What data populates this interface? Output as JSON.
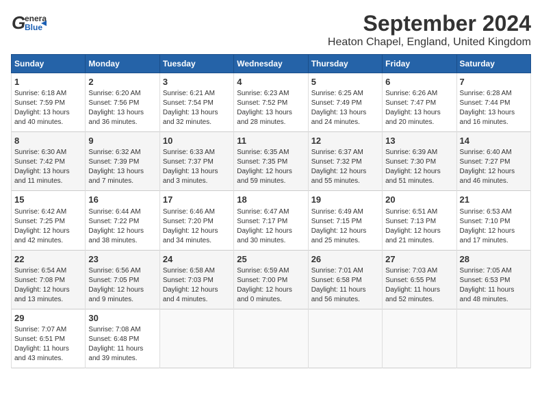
{
  "header": {
    "logo_general": "General",
    "logo_blue": "Blue",
    "title": "September 2024",
    "subtitle": "Heaton Chapel, England, United Kingdom"
  },
  "days_of_week": [
    "Sunday",
    "Monday",
    "Tuesday",
    "Wednesday",
    "Thursday",
    "Friday",
    "Saturday"
  ],
  "weeks": [
    [
      {
        "day": "1",
        "lines": [
          "Sunrise: 6:18 AM",
          "Sunset: 7:59 PM",
          "Daylight: 13 hours",
          "and 40 minutes."
        ]
      },
      {
        "day": "2",
        "lines": [
          "Sunrise: 6:20 AM",
          "Sunset: 7:56 PM",
          "Daylight: 13 hours",
          "and 36 minutes."
        ]
      },
      {
        "day": "3",
        "lines": [
          "Sunrise: 6:21 AM",
          "Sunset: 7:54 PM",
          "Daylight: 13 hours",
          "and 32 minutes."
        ]
      },
      {
        "day": "4",
        "lines": [
          "Sunrise: 6:23 AM",
          "Sunset: 7:52 PM",
          "Daylight: 13 hours",
          "and 28 minutes."
        ]
      },
      {
        "day": "5",
        "lines": [
          "Sunrise: 6:25 AM",
          "Sunset: 7:49 PM",
          "Daylight: 13 hours",
          "and 24 minutes."
        ]
      },
      {
        "day": "6",
        "lines": [
          "Sunrise: 6:26 AM",
          "Sunset: 7:47 PM",
          "Daylight: 13 hours",
          "and 20 minutes."
        ]
      },
      {
        "day": "7",
        "lines": [
          "Sunrise: 6:28 AM",
          "Sunset: 7:44 PM",
          "Daylight: 13 hours",
          "and 16 minutes."
        ]
      }
    ],
    [
      {
        "day": "8",
        "lines": [
          "Sunrise: 6:30 AM",
          "Sunset: 7:42 PM",
          "Daylight: 13 hours",
          "and 11 minutes."
        ]
      },
      {
        "day": "9",
        "lines": [
          "Sunrise: 6:32 AM",
          "Sunset: 7:39 PM",
          "Daylight: 13 hours",
          "and 7 minutes."
        ]
      },
      {
        "day": "10",
        "lines": [
          "Sunrise: 6:33 AM",
          "Sunset: 7:37 PM",
          "Daylight: 13 hours",
          "and 3 minutes."
        ]
      },
      {
        "day": "11",
        "lines": [
          "Sunrise: 6:35 AM",
          "Sunset: 7:35 PM",
          "Daylight: 12 hours",
          "and 59 minutes."
        ]
      },
      {
        "day": "12",
        "lines": [
          "Sunrise: 6:37 AM",
          "Sunset: 7:32 PM",
          "Daylight: 12 hours",
          "and 55 minutes."
        ]
      },
      {
        "day": "13",
        "lines": [
          "Sunrise: 6:39 AM",
          "Sunset: 7:30 PM",
          "Daylight: 12 hours",
          "and 51 minutes."
        ]
      },
      {
        "day": "14",
        "lines": [
          "Sunrise: 6:40 AM",
          "Sunset: 7:27 PM",
          "Daylight: 12 hours",
          "and 46 minutes."
        ]
      }
    ],
    [
      {
        "day": "15",
        "lines": [
          "Sunrise: 6:42 AM",
          "Sunset: 7:25 PM",
          "Daylight: 12 hours",
          "and 42 minutes."
        ]
      },
      {
        "day": "16",
        "lines": [
          "Sunrise: 6:44 AM",
          "Sunset: 7:22 PM",
          "Daylight: 12 hours",
          "and 38 minutes."
        ]
      },
      {
        "day": "17",
        "lines": [
          "Sunrise: 6:46 AM",
          "Sunset: 7:20 PM",
          "Daylight: 12 hours",
          "and 34 minutes."
        ]
      },
      {
        "day": "18",
        "lines": [
          "Sunrise: 6:47 AM",
          "Sunset: 7:17 PM",
          "Daylight: 12 hours",
          "and 30 minutes."
        ]
      },
      {
        "day": "19",
        "lines": [
          "Sunrise: 6:49 AM",
          "Sunset: 7:15 PM",
          "Daylight: 12 hours",
          "and 25 minutes."
        ]
      },
      {
        "day": "20",
        "lines": [
          "Sunrise: 6:51 AM",
          "Sunset: 7:13 PM",
          "Daylight: 12 hours",
          "and 21 minutes."
        ]
      },
      {
        "day": "21",
        "lines": [
          "Sunrise: 6:53 AM",
          "Sunset: 7:10 PM",
          "Daylight: 12 hours",
          "and 17 minutes."
        ]
      }
    ],
    [
      {
        "day": "22",
        "lines": [
          "Sunrise: 6:54 AM",
          "Sunset: 7:08 PM",
          "Daylight: 12 hours",
          "and 13 minutes."
        ]
      },
      {
        "day": "23",
        "lines": [
          "Sunrise: 6:56 AM",
          "Sunset: 7:05 PM",
          "Daylight: 12 hours",
          "and 9 minutes."
        ]
      },
      {
        "day": "24",
        "lines": [
          "Sunrise: 6:58 AM",
          "Sunset: 7:03 PM",
          "Daylight: 12 hours",
          "and 4 minutes."
        ]
      },
      {
        "day": "25",
        "lines": [
          "Sunrise: 6:59 AM",
          "Sunset: 7:00 PM",
          "Daylight: 12 hours",
          "and 0 minutes."
        ]
      },
      {
        "day": "26",
        "lines": [
          "Sunrise: 7:01 AM",
          "Sunset: 6:58 PM",
          "Daylight: 11 hours",
          "and 56 minutes."
        ]
      },
      {
        "day": "27",
        "lines": [
          "Sunrise: 7:03 AM",
          "Sunset: 6:55 PM",
          "Daylight: 11 hours",
          "and 52 minutes."
        ]
      },
      {
        "day": "28",
        "lines": [
          "Sunrise: 7:05 AM",
          "Sunset: 6:53 PM",
          "Daylight: 11 hours",
          "and 48 minutes."
        ]
      }
    ],
    [
      {
        "day": "29",
        "lines": [
          "Sunrise: 7:07 AM",
          "Sunset: 6:51 PM",
          "Daylight: 11 hours",
          "and 43 minutes."
        ]
      },
      {
        "day": "30",
        "lines": [
          "Sunrise: 7:08 AM",
          "Sunset: 6:48 PM",
          "Daylight: 11 hours",
          "and 39 minutes."
        ]
      },
      null,
      null,
      null,
      null,
      null
    ]
  ]
}
